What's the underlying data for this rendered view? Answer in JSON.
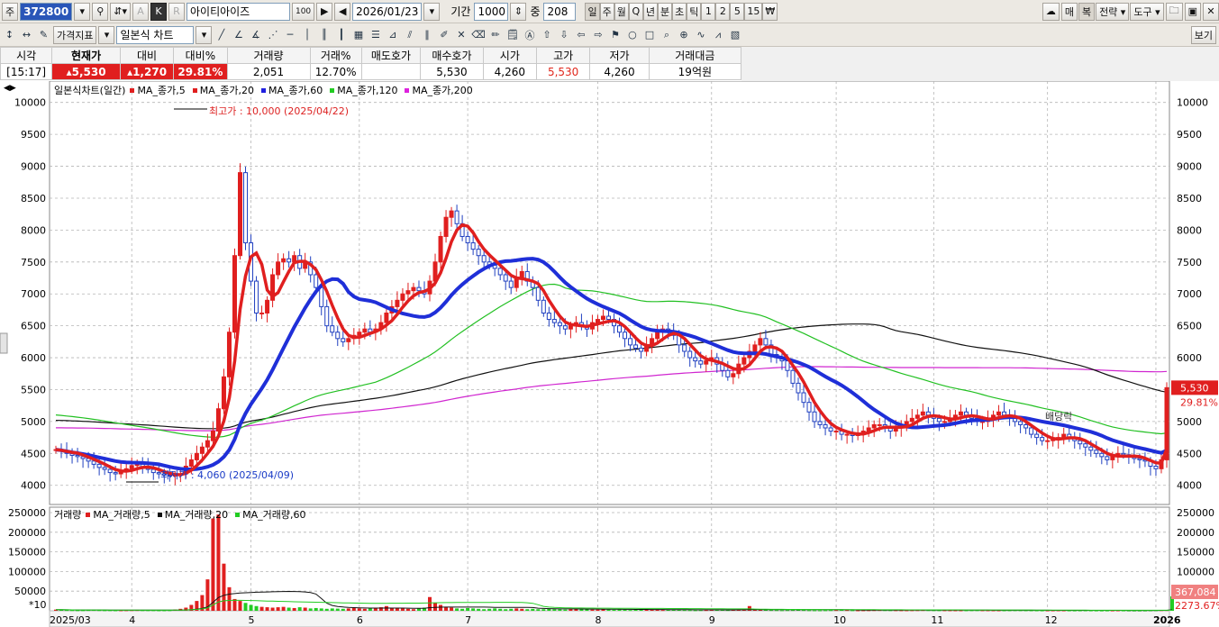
{
  "toolbar1": {
    "market_label": "주",
    "stock_code": "372800",
    "stock_name": "아이티아이즈",
    "date": "2026/01/23",
    "period_label": "기간",
    "period_value": "1000",
    "count_label": "중",
    "count_value": "208",
    "cycle_buttons": [
      "일",
      "주",
      "월",
      "Q",
      "년",
      "분",
      "초",
      "틱",
      "1",
      "2",
      "5",
      "15",
      "₩"
    ],
    "right_buttons": [
      "매",
      "복",
      "전략",
      "도구"
    ],
    "a_button": "A",
    "k_button": "K",
    "hundred": "100"
  },
  "toolbar2": {
    "indicator_button": "가격지표",
    "chart_type": "일본식 차트",
    "view_button": "보기"
  },
  "quote": {
    "headers": [
      "시각",
      "현재가",
      "대비",
      "대비%",
      "거래량",
      "거래%",
      "매도호가",
      "매수호가",
      "시가",
      "고가",
      "저가",
      "거래대금"
    ],
    "values": [
      "[15:17]",
      "▴5,530",
      "▴1,270",
      "29.81%",
      "2,051",
      "12.70%",
      "",
      "5,530",
      "4,260",
      "5,530",
      "4,260",
      "19억원"
    ]
  },
  "price_legend": {
    "title": "일본식차트(일간)",
    "items": [
      {
        "label": "MA_종가,5",
        "color": "#e01f1f"
      },
      {
        "label": "MA_종가,20",
        "color": "#e01f1f"
      },
      {
        "label": "MA_종가,60",
        "color": "#2020e0"
      },
      {
        "label": "MA_종가,120",
        "color": "#22cc22"
      },
      {
        "label": "MA_종가,200",
        "color": "#dd22dd"
      }
    ]
  },
  "volume_legend": {
    "title": "거래량",
    "items": [
      {
        "label": "MA_거래량,5",
        "color": "#e01f1f"
      },
      {
        "label": "MA_거래량,20",
        "color": "#111111"
      },
      {
        "label": "MA_거래량,60",
        "color": "#22cc22"
      }
    ]
  },
  "annotations": {
    "high": "최고가 : 10,000 (2025/04/22)",
    "low": "최저가 : 4,060 (2025/04/09)",
    "dividend": "배당락",
    "vol_scale": "*10"
  },
  "right_tags": {
    "price": "5,530",
    "pct": "29.81%",
    "volume": "367,084",
    "vol_pct": "2273.67%"
  },
  "colors": {
    "up": "#e01f1f",
    "down": "#2040c0",
    "ma5": "#e01f1f",
    "ma20": "#1f2fd8",
    "ma60": "#111111",
    "ma120": "#22c022",
    "ma200": "#d026d0",
    "grid": "#b5b5b5"
  },
  "chart_data": {
    "type": "candlestick",
    "price_axis": {
      "min": 3700,
      "max": 10250,
      "ticks": [
        4000,
        4500,
        5000,
        5500,
        6000,
        6500,
        7000,
        7500,
        8000,
        8500,
        9000,
        9500,
        10000
      ]
    },
    "volume_axis": {
      "min": 0,
      "max": 250000,
      "ticks": [
        50000,
        100000,
        150000,
        200000,
        250000
      ]
    },
    "x_labels": [
      {
        "label": "2025/03",
        "i": 0
      },
      {
        "label": "4",
        "i": 14
      },
      {
        "label": "5",
        "i": 36
      },
      {
        "label": "6",
        "i": 56
      },
      {
        "label": "7",
        "i": 76
      },
      {
        "label": "8",
        "i": 100
      },
      {
        "label": "9",
        "i": 121
      },
      {
        "label": "10",
        "i": 144
      },
      {
        "label": "11",
        "i": 162
      },
      {
        "label": "12",
        "i": 183
      },
      {
        "label": "2026",
        "i": 203
      }
    ],
    "closes": [
      4560,
      4540,
      4500,
      4470,
      4450,
      4420,
      4380,
      4330,
      4280,
      4250,
      4200,
      4180,
      4220,
      4260,
      4310,
      4330,
      4280,
      4250,
      4200,
      4180,
      4160,
      4150,
      4160,
      4180,
      4300,
      4400,
      4500,
      4600,
      4700,
      4850,
      5200,
      5700,
      6400,
      7600,
      8900,
      7800,
      7200,
      6700,
      6700,
      6900,
      7300,
      7500,
      7550,
      7500,
      7600,
      7400,
      7500,
      7300,
      7100,
      6800,
      6500,
      6400,
      6300,
      6250,
      6300,
      6350,
      6400,
      6450,
      6400,
      6450,
      6550,
      6700,
      6800,
      6900,
      7000,
      7050,
      7100,
      7050,
      7000,
      7200,
      7500,
      7900,
      8200,
      8300,
      8100,
      7900,
      7800,
      7700,
      7600,
      7500,
      7450,
      7400,
      7300,
      7200,
      7100,
      7250,
      7350,
      7200,
      7100,
      6900,
      6700,
      6600,
      6550,
      6500,
      6450,
      6500,
      6550,
      6500,
      6450,
      6550,
      6600,
      6650,
      6600,
      6500,
      6400,
      6300,
      6200,
      6150,
      6100,
      6200,
      6300,
      6400,
      6450,
      6400,
      6350,
      6200,
      6100,
      6000,
      5950,
      5900,
      5950,
      6000,
      5900,
      5800,
      5700,
      5750,
      5900,
      6000,
      6100,
      6200,
      6300,
      6200,
      6050,
      6000,
      5950,
      5800,
      5600,
      5450,
      5300,
      5150,
      5000,
      4950,
      4900,
      4850,
      4850,
      4800,
      4800,
      4780,
      4800,
      4850,
      4900,
      4950,
      4950,
      4900,
      4850,
      4900,
      4950,
      5000,
      5050,
      5100,
      5150,
      5100,
      5050,
      5000,
      5000,
      5050,
      5100,
      5150,
      5100,
      5050,
      5000,
      5000,
      5050,
      5100,
      5150,
      5100,
      5050,
      5000,
      4950,
      4900,
      4800,
      4750,
      4700,
      4700,
      4720,
      4750,
      4800,
      4750,
      4700,
      4650,
      4600,
      4550,
      4500,
      4450,
      4400,
      4450,
      4500,
      4480,
      4450,
      4420,
      4400,
      4380,
      4300,
      4260,
      4400,
      5530
    ],
    "volumes": [
      3000,
      2500,
      2000,
      1800,
      1500,
      1600,
      2000,
      2200,
      1800,
      1500,
      1500,
      1200,
      1300,
      1500,
      1800,
      2000,
      1600,
      1500,
      1500,
      1200,
      1300,
      1500,
      3000,
      5000,
      8000,
      15000,
      25000,
      40000,
      80000,
      235000,
      245000,
      120000,
      60000,
      30000,
      25000,
      20000,
      15000,
      12000,
      10000,
      9000,
      8000,
      9000,
      10000,
      8000,
      7000,
      9000,
      8000,
      6000,
      7000,
      6000,
      5000,
      6000,
      5500,
      5000,
      6000,
      7000,
      6000,
      5000,
      6000,
      7000,
      9000,
      12000,
      8000,
      7000,
      6000,
      5000,
      4000,
      6000,
      8000,
      35000,
      20000,
      15000,
      10000,
      8000,
      6000,
      5000,
      7000,
      6000,
      5000,
      4000,
      5000,
      6000,
      5000,
      4000,
      5000,
      6000,
      5000,
      4000,
      5000,
      4000,
      4000,
      5000,
      4000,
      3500,
      3000,
      4000,
      5000,
      4000,
      3500,
      3000,
      3000,
      3500,
      3000,
      2500,
      3000,
      2500,
      2000,
      2500,
      3000,
      3500,
      3000,
      2500,
      2000,
      2500,
      3000,
      2500,
      2000,
      1800,
      1500,
      1800,
      2000,
      2500,
      3000,
      2500,
      2000,
      2500,
      3000,
      3500,
      12000,
      4000,
      3000,
      2500,
      2000,
      1800,
      1500,
      1800,
      2000,
      2500,
      2000,
      1500,
      1300,
      1200,
      1500,
      1800,
      2000,
      2500,
      2000,
      1500,
      1200,
      1300,
      1500,
      1800,
      2000,
      1800,
      1600,
      1500,
      1400,
      1300,
      1500,
      1700,
      2000,
      1800,
      1600,
      1500,
      1400,
      1300,
      1200,
      1200,
      1300,
      1500,
      1600,
      1400,
      1300,
      1200,
      1100,
      1200,
      1300,
      1500,
      1400,
      1300,
      1200,
      1100,
      1000,
      1000,
      1100,
      1200,
      1100,
      1000,
      900,
      1000,
      1100,
      1000,
      900,
      800,
      900,
      1000,
      1100,
      1000,
      900,
      800,
      800,
      900,
      1200,
      1500,
      1800,
      2000,
      36708
    ]
  }
}
